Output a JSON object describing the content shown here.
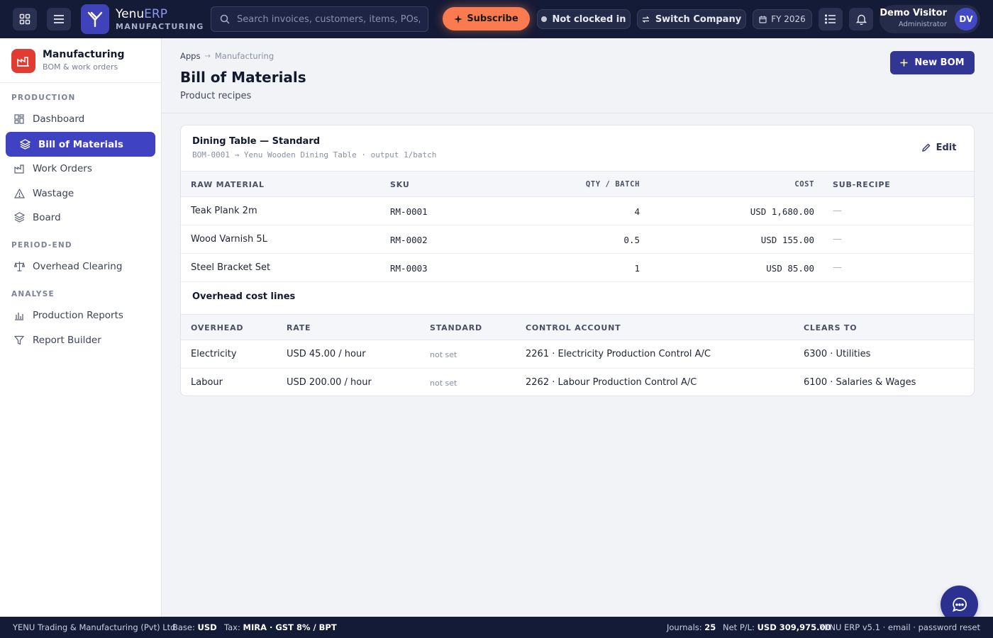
{
  "topbar": {
    "brand_name": "Yenu",
    "brand_name_accent": "ERP",
    "brand_sub": "MANUFACTURING",
    "search_placeholder": "Search invoices, customers, items, POs, bills…",
    "subscribe_label": "Subscribe",
    "clock_status": "Not clocked in",
    "switch_company_label": "Switch Company",
    "fiscal_year": "FY 2026",
    "user_name": "Demo Visitor",
    "user_role": "Administrator",
    "user_initials": "DV"
  },
  "sidebar": {
    "module_title": "Manufacturing",
    "module_sub": "BOM & work orders",
    "sections": {
      "production": "PRODUCTION",
      "period_end": "PERIOD-END",
      "analyse": "ANALYSE"
    },
    "items": {
      "dashboard": "Dashboard",
      "bom": "Bill of Materials",
      "work_orders": "Work Orders",
      "wastage": "Wastage",
      "board": "Board",
      "overhead_clearing": "Overhead Clearing",
      "production_reports": "Production Reports",
      "report_builder": "Report Builder"
    },
    "active_item": "bom"
  },
  "page": {
    "breadcrumb": [
      "Apps",
      "Manufacturing"
    ],
    "title": "Bill of Materials",
    "subtitle": "Product recipes",
    "new_button": "New BOM"
  },
  "bom": {
    "title": "Dining Table — Standard",
    "subtitle": "BOM-0001 → Yenu Wooden Dining Table · output 1/batch",
    "edit_label": "Edit",
    "columns": [
      "RAW MATERIAL",
      "SKU",
      "QTY / BATCH",
      "COST",
      "SUB-RECIPE"
    ],
    "rows": [
      {
        "material": "Teak Plank 2m",
        "sku": "RM-0001",
        "qty": "4",
        "cost": "USD 1,680.00",
        "sub_recipe": "—"
      },
      {
        "material": "Wood Varnish 5L",
        "sku": "RM-0002",
        "qty": "0.5",
        "cost": "USD 155.00",
        "sub_recipe": "—"
      },
      {
        "material": "Steel Bracket Set",
        "sku": "RM-0003",
        "qty": "1",
        "cost": "USD 85.00",
        "sub_recipe": "—"
      }
    ],
    "overhead_title": "Overhead cost lines",
    "overhead_columns": [
      "OVERHEAD",
      "RATE",
      "STANDARD",
      "CONTROL ACCOUNT",
      "CLEARS TO"
    ],
    "overhead_rows": [
      {
        "overhead": "Electricity",
        "rate": "USD 45.00 / hour",
        "standard": "not set",
        "control_account": "2261 · Electricity Production Control A/C",
        "clears_to": "6300 · Utilities"
      },
      {
        "overhead": "Labour",
        "rate": "USD 200.00 / hour",
        "standard": "not set",
        "control_account": "2262 · Labour Production Control A/C",
        "clears_to": "6100 · Salaries & Wages"
      }
    ]
  },
  "footer": {
    "company": "YENU Trading & Manufacturing (Pvt) Ltd",
    "base_label": "Base:",
    "base_value": "USD",
    "tax_label": "Tax:",
    "tax_value": "MIRA · GST 8% / BPT",
    "journals_label": "Journals:",
    "journals_value": "25",
    "pnl_label": "Net P/L:",
    "pnl_value": "USD 309,975.00",
    "version": "YENU ERP v5.1 · email · password reset"
  },
  "colors": {
    "topbar": "#141b36",
    "accent": "#3f42c3",
    "subscribe": "#f97b4f",
    "module_icon": "#e03c31"
  }
}
